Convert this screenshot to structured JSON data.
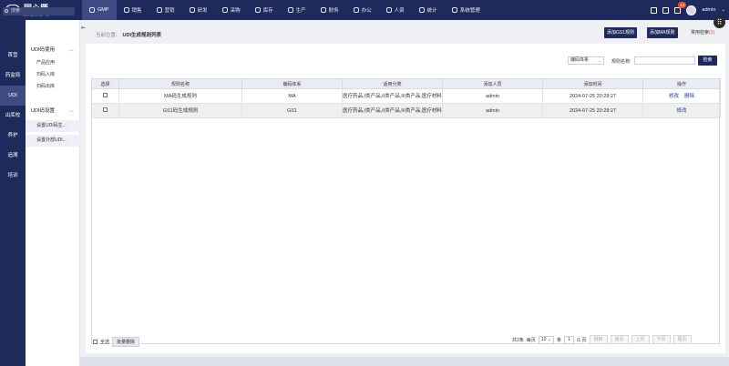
{
  "app": {
    "logo_title": "同心雁",
    "logo_subtitle": "医疗器械 | 生产版"
  },
  "topnav": [
    {
      "label": "GMP",
      "icon": "gmp-icon",
      "active": true
    },
    {
      "label": "销售",
      "icon": "sales-icon"
    },
    {
      "label": "营销",
      "icon": "marketing-icon"
    },
    {
      "label": "研发",
      "icon": "rnd-icon"
    },
    {
      "label": "采购",
      "icon": "purchase-icon"
    },
    {
      "label": "库存",
      "icon": "inventory-icon"
    },
    {
      "label": "生产",
      "icon": "production-icon"
    },
    {
      "label": "财务",
      "icon": "finance-icon"
    },
    {
      "label": "办公",
      "icon": "office-icon"
    },
    {
      "label": "人资",
      "icon": "hr-icon"
    },
    {
      "label": "统计",
      "icon": "stats-icon"
    },
    {
      "label": "系统管理",
      "icon": "system-icon"
    }
  ],
  "topright": {
    "notification_count": "14",
    "username": "admin"
  },
  "sidebar": {
    "search_placeholder": "搜索",
    "items": [
      {
        "label": "首营"
      },
      {
        "label": "药监局"
      },
      {
        "label": "UDI",
        "active": true
      },
      {
        "label": "出库校"
      },
      {
        "label": "养护"
      },
      {
        "label": "追溯"
      },
      {
        "label": "培训"
      }
    ]
  },
  "submenu": {
    "groups": [
      {
        "label": "UDI码使用",
        "items": [
          "产品应用",
          "扫码入库",
          "扫码出库"
        ]
      },
      {
        "label": "UDI码设置",
        "items": [
          "设置UDI码生...",
          "设置外部UDI..."
        ]
      }
    ]
  },
  "header": {
    "breadcrumb_prefix": "当前位置:",
    "breadcrumb_current": "UDI生成规则列表",
    "btn_add_gs1": "添加GS1规则",
    "btn_add_ma": "添加MA规则",
    "common_search": "常用检索",
    "common_search_count": "(1)"
  },
  "filter": {
    "select_value": "编码体系",
    "rule_name_label": "规则名称:",
    "rule_name_value": "",
    "search_btn": "检索"
  },
  "table": {
    "columns": [
      "选择",
      "规则名称",
      "编码体系",
      "适用分类",
      "添加人员",
      "添加时间",
      "操作"
    ],
    "rows": [
      {
        "name": "MA码生成规则",
        "system": "MA",
        "category": "医疗药品,I类产品,II类产品,III类产品,医疗材料",
        "user": "admin",
        "time": "2024-07-25 20:28:27",
        "actions": [
          "修改",
          "删除"
        ]
      },
      {
        "name": "GS1码生成规则",
        "system": "GS1",
        "category": "医疗药品,I类产品,II类产品,III类产品,医疗材料",
        "user": "admin",
        "time": "2024-07-25 20:28:27",
        "actions": [
          "修改"
        ]
      }
    ]
  },
  "footer": {
    "select_all": "全选",
    "batch_delete": "批量删除",
    "total": "共2条",
    "per_page_label": "每页",
    "per_page_value": "10",
    "per_page_unit": "条",
    "page_value": "1",
    "page_total": "/1 页",
    "btn_jump": "跳转",
    "btn_first": "首页",
    "btn_prev": "上页",
    "btn_next": "下页",
    "btn_last": "尾页"
  }
}
